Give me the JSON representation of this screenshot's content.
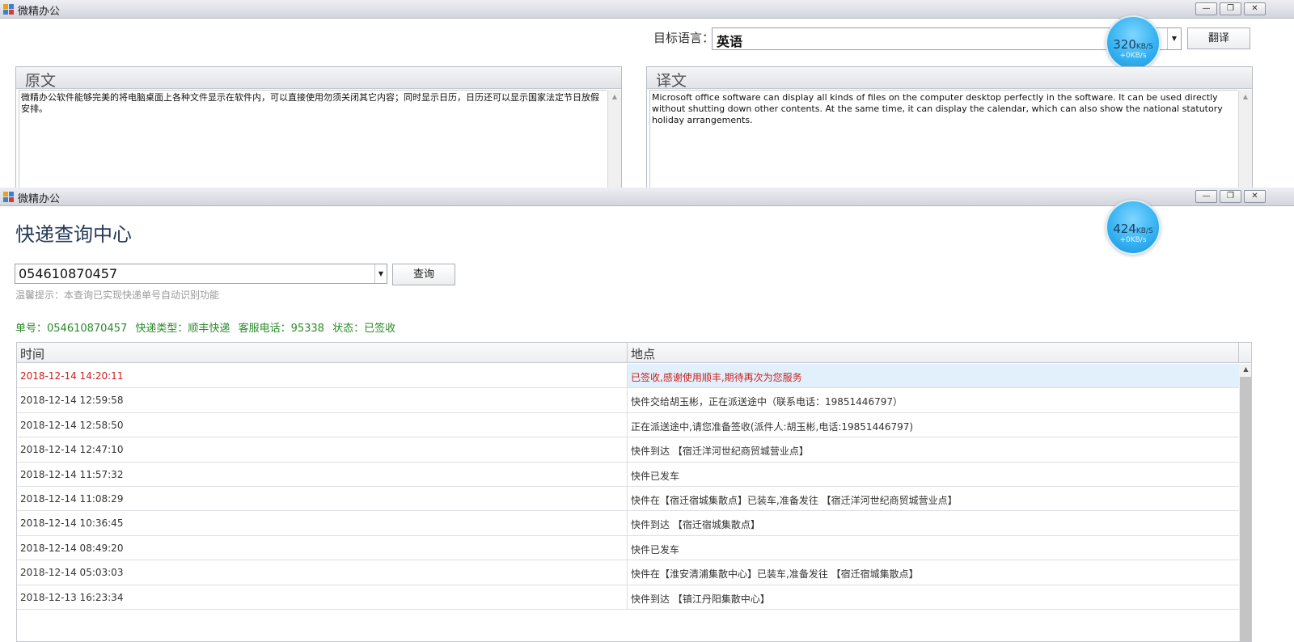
{
  "translate_window": {
    "title": "微精办公",
    "controls": {
      "minimize": "—",
      "maximize": "❐",
      "close": "✕"
    },
    "target_language_label": "目标语言：",
    "target_language_value": "英语",
    "translate_button": "翻译",
    "speed": {
      "main": "320",
      "unit": "KB/S",
      "sub": "+0KB/s"
    },
    "source_panel_title": "原文",
    "source_text": "微精办公软件能够完美的将电脑桌面上各种文件显示在软件内，可以直接使用勿须关闭其它内容；同时显示日历，日历还可以显示国家法定节日放假安排。",
    "target_panel_title": "译文",
    "target_text": "Microsoft office software can display all kinds of files on the computer desktop perfectly in the software. It can be used directly without shutting down other contents. At the same time, it can display the calendar, which can also show the national statutory holiday arrangements."
  },
  "express_window": {
    "title": "微精办公",
    "controls": {
      "minimize": "—",
      "maximize": "❐",
      "close": "✕"
    },
    "speed": {
      "main": "424",
      "unit": "KB/S",
      "sub": "+0KB/s"
    },
    "page_title": "快递查询中心",
    "tracking_input_value": "054610870457",
    "query_button": "查询",
    "tip": "温馨提示：本查询已实现快递单号自动识别功能",
    "info": {
      "number": "单号：054610870457",
      "type": "快递类型：顺丰快递",
      "phone": "客服电话：95338",
      "status": "状态：已签收"
    },
    "table": {
      "headers": {
        "time": "时间",
        "location": "地点"
      },
      "rows": [
        {
          "time": "2018-12-14 14:20:11",
          "location": "已签收,感谢使用顺丰,期待再次为您服务"
        },
        {
          "time": "2018-12-14 12:59:58",
          "location": "快件交给胡玉彬，正在派送途中（联系电话：19851446797）"
        },
        {
          "time": "2018-12-14 12:58:50",
          "location": "正在派送途中,请您准备签收(派件人:胡玉彬,电话:19851446797)"
        },
        {
          "time": "2018-12-14 12:47:10",
          "location": "快件到达 【宿迁洋河世纪商贸城营业点】"
        },
        {
          "time": "2018-12-14 11:57:32",
          "location": "快件已发车"
        },
        {
          "time": "2018-12-14 11:08:29",
          "location": "快件在【宿迁宿城集散点】已装车,准备发往 【宿迁洋河世纪商贸城营业点】"
        },
        {
          "time": "2018-12-14 10:36:45",
          "location": "快件到达 【宿迁宿城集散点】"
        },
        {
          "time": "2018-12-14 08:49:20",
          "location": "快件已发车"
        },
        {
          "time": "2018-12-14 05:03:03",
          "location": "快件在【淮安清浦集散中心】已装车,准备发往 【宿迁宿城集散点】"
        },
        {
          "time": "2018-12-13 16:23:34",
          "location": "快件到达 【镇江丹阳集散中心】"
        }
      ]
    }
  }
}
